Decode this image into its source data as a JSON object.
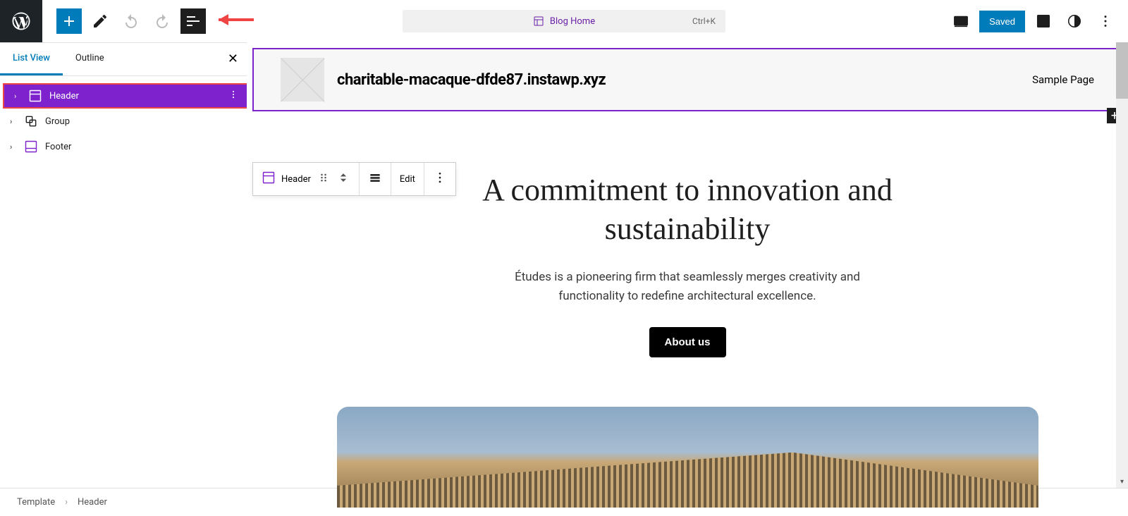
{
  "topbar": {
    "center_label": "Blog Home",
    "center_shortcut": "Ctrl+K",
    "saved_label": "Saved"
  },
  "sidebar": {
    "tabs": [
      "List View",
      "Outline"
    ],
    "items": [
      {
        "label": "Header",
        "selected": true,
        "icon": "template-part"
      },
      {
        "label": "Group",
        "selected": false,
        "icon": "group"
      },
      {
        "label": "Footer",
        "selected": false,
        "icon": "template-part"
      }
    ]
  },
  "headerBlock": {
    "site_title": "charitable-macaque-dfde87.instawp.xyz",
    "nav_link": "Sample Page"
  },
  "floatingToolbar": {
    "block_label": "Header",
    "edit_label": "Edit"
  },
  "hero": {
    "title": "A commitment to innovation and sustainability",
    "subtitle": "Études is a pioneering firm that seamlessly merges creativity and functionality to redefine architectural excellence.",
    "button": "About us"
  },
  "breadcrumb": {
    "root": "Template",
    "current": "Header"
  }
}
